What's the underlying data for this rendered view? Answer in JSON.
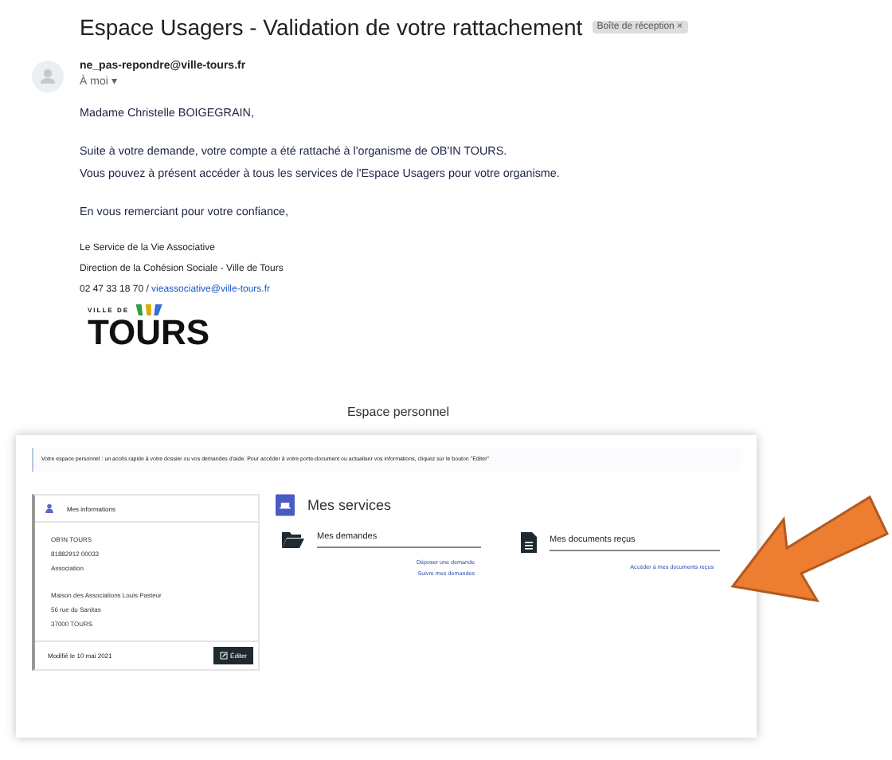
{
  "email": {
    "subject": "Espace Usagers - Validation de votre rattachement",
    "label": "Boîte de réception ×",
    "sender": "ne_pas-repondre@ville-tours.fr",
    "recipient": "À moi ▾",
    "greeting": "Madame Christelle BOIGEGRAIN,",
    "paragraph": [
      "Suite à votre demande, votre compte a été rattaché à l'organisme de OB'IN TOURS.",
      "Vous pouvez à présent accéder à tous les services de l'Espace Usagers pour votre organisme."
    ],
    "closing": "En vous remerciant pour votre confiance,",
    "signature": [
      "Le Service de la Vie Associative",
      "Direction de la Cohésion Sociale - Ville de Tours"
    ],
    "phone": "02 47 33 18 70 / ",
    "signature_email": "vieassociative@ville-tours.fr",
    "logo": {
      "small": "VILLE DE",
      "big": "TOURS"
    }
  },
  "embedded": {
    "page_title": "Espace personnel",
    "notice": "Votre espace personnel : un accès rapide à votre dossier ou vos demandes d'aide. Pour accéder à votre porte-document ou actualiser vos informations, cliquez sur le bouton \"Éditer\"",
    "info_panel": {
      "title": "Mes informations",
      "lines": [
        "OB'IN TOURS",
        "81882912 00033",
        "Association"
      ],
      "address": [
        "Maison des Associations Louis Pasteur",
        "56 rue du Sanitas",
        "37000 TOURS"
      ],
      "modified": "Modifié le 10 mai 2021",
      "edit_button": "Éditer"
    },
    "services_title": "Mes services",
    "services": [
      {
        "kind": "folder",
        "title": "Mes demandes",
        "links": [
          "Déposer une demande",
          "Suivre mes demandes"
        ]
      },
      {
        "kind": "document",
        "title": "Mes documents reçus",
        "links": [
          "Accéder à mes documents reçus"
        ]
      }
    ]
  }
}
